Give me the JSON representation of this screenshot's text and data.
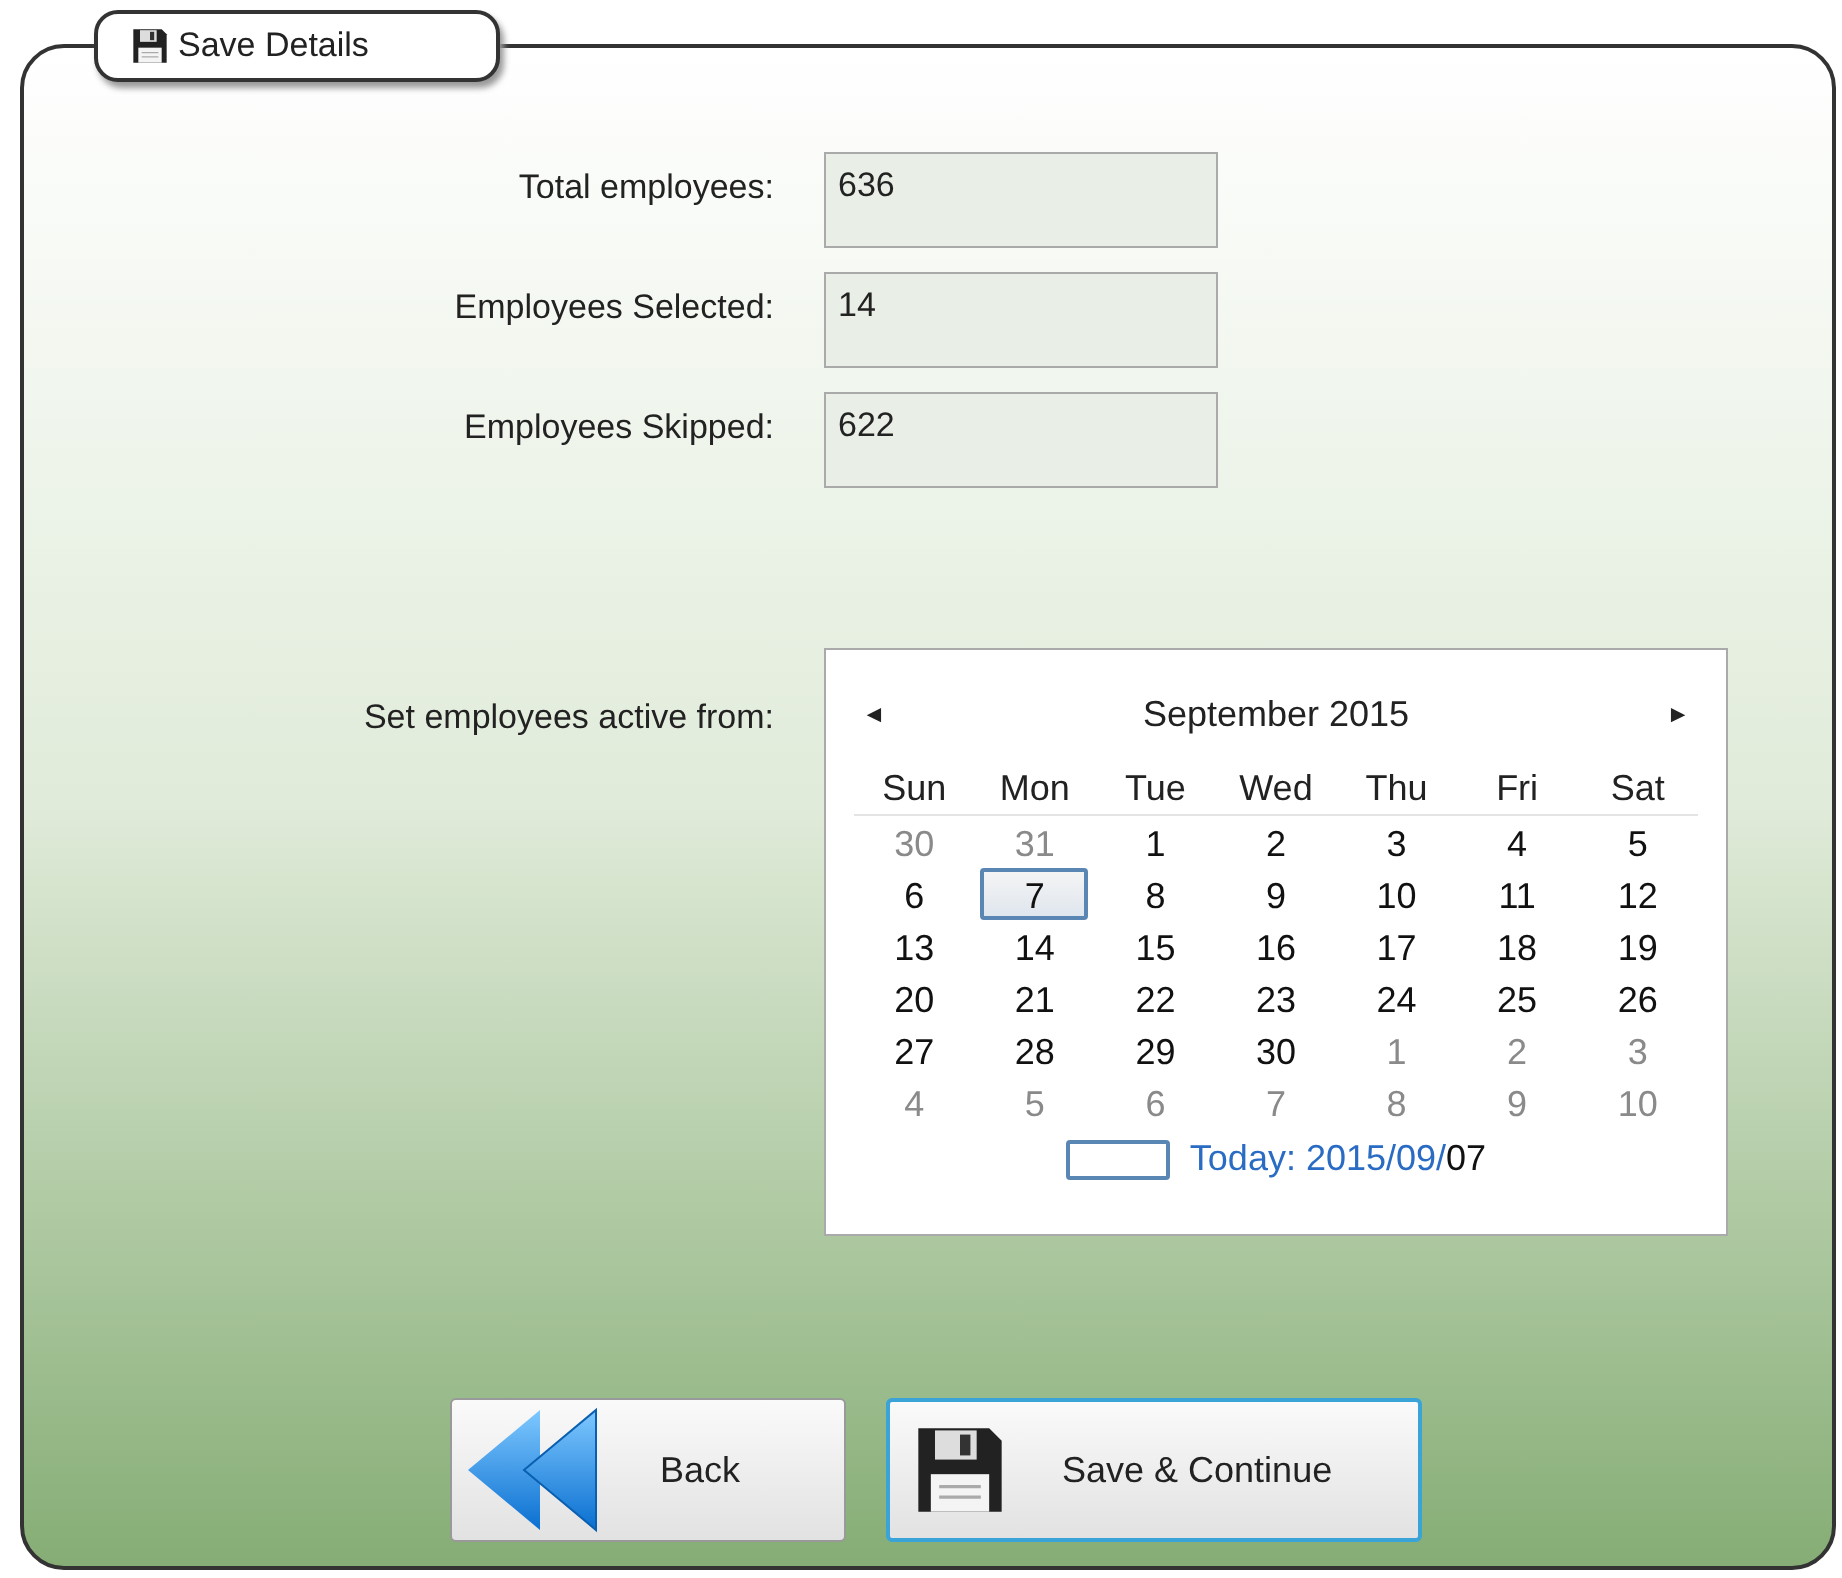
{
  "group": {
    "title": "Save Details"
  },
  "stats": [
    {
      "label": "Total employees:",
      "value": "636"
    },
    {
      "label": "Employees Selected:",
      "value": "14"
    },
    {
      "label": "Employees Skipped:",
      "value": "622"
    }
  ],
  "date_label": "Set employees active from:",
  "calendar": {
    "prev": "◄",
    "next": "►",
    "month": "September 2015",
    "weekdays": [
      "Sun",
      "Mon",
      "Tue",
      "Wed",
      "Thu",
      "Fri",
      "Sat"
    ],
    "days": [
      {
        "day": "30",
        "in_month": false,
        "selected": false
      },
      {
        "day": "31",
        "in_month": false,
        "selected": false
      },
      {
        "day": "1",
        "in_month": true,
        "selected": false
      },
      {
        "day": "2",
        "in_month": true,
        "selected": false
      },
      {
        "day": "3",
        "in_month": true,
        "selected": false
      },
      {
        "day": "4",
        "in_month": true,
        "selected": false
      },
      {
        "day": "5",
        "in_month": true,
        "selected": false
      },
      {
        "day": "6",
        "in_month": true,
        "selected": false
      },
      {
        "day": "7",
        "in_month": true,
        "selected": true
      },
      {
        "day": "8",
        "in_month": true,
        "selected": false
      },
      {
        "day": "9",
        "in_month": true,
        "selected": false
      },
      {
        "day": "10",
        "in_month": true,
        "selected": false
      },
      {
        "day": "11",
        "in_month": true,
        "selected": false
      },
      {
        "day": "12",
        "in_month": true,
        "selected": false
      },
      {
        "day": "13",
        "in_month": true,
        "selected": false
      },
      {
        "day": "14",
        "in_month": true,
        "selected": false
      },
      {
        "day": "15",
        "in_month": true,
        "selected": false
      },
      {
        "day": "16",
        "in_month": true,
        "selected": false
      },
      {
        "day": "17",
        "in_month": true,
        "selected": false
      },
      {
        "day": "18",
        "in_month": true,
        "selected": false
      },
      {
        "day": "19",
        "in_month": true,
        "selected": false
      },
      {
        "day": "20",
        "in_month": true,
        "selected": false
      },
      {
        "day": "21",
        "in_month": true,
        "selected": false
      },
      {
        "day": "22",
        "in_month": true,
        "selected": false
      },
      {
        "day": "23",
        "in_month": true,
        "selected": false
      },
      {
        "day": "24",
        "in_month": true,
        "selected": false
      },
      {
        "day": "25",
        "in_month": true,
        "selected": false
      },
      {
        "day": "26",
        "in_month": true,
        "selected": false
      },
      {
        "day": "27",
        "in_month": true,
        "selected": false
      },
      {
        "day": "28",
        "in_month": true,
        "selected": false
      },
      {
        "day": "29",
        "in_month": true,
        "selected": false
      },
      {
        "day": "30",
        "in_month": true,
        "selected": false
      },
      {
        "day": "1",
        "in_month": false,
        "selected": false
      },
      {
        "day": "2",
        "in_month": false,
        "selected": false
      },
      {
        "day": "3",
        "in_month": false,
        "selected": false
      },
      {
        "day": "4",
        "in_month": false,
        "selected": false
      },
      {
        "day": "5",
        "in_month": false,
        "selected": false
      },
      {
        "day": "6",
        "in_month": false,
        "selected": false
      },
      {
        "day": "7",
        "in_month": false,
        "selected": false
      },
      {
        "day": "8",
        "in_month": false,
        "selected": false
      },
      {
        "day": "9",
        "in_month": false,
        "selected": false
      },
      {
        "day": "10",
        "in_month": false,
        "selected": false
      }
    ],
    "today_prefix": "Today: 2015/09/",
    "today_suffix": "07"
  },
  "buttons": [
    {
      "kind": "back",
      "label": "Back",
      "selected": false
    },
    {
      "kind": "save",
      "label": "Save & Continue",
      "selected": true
    }
  ]
}
